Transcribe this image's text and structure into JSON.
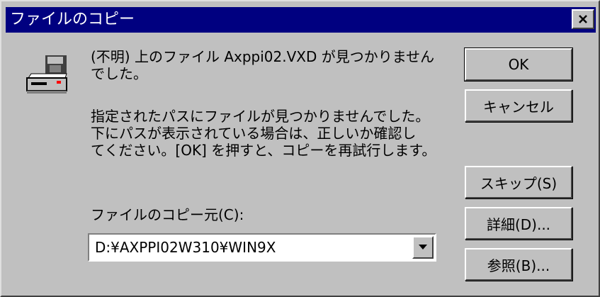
{
  "window": {
    "title": "ファイルのコピー"
  },
  "message": {
    "line1": "(不明) 上のファイル Axppi02.VXD が見つかりません",
    "line2": "でした。",
    "detail_line1": "指定されたパスにファイルが見つかりませんでした。",
    "detail_line2": "下にパスが表示されている場合は、正しいか確認し",
    "detail_line3": "てください。[OK] を押すと、コピーを再試行します。"
  },
  "source": {
    "label": "ファイルのコピー元(C):",
    "value": "D:¥AXPPI02W310¥WIN9X"
  },
  "buttons": {
    "ok": "OK",
    "cancel": "キャンセル",
    "skip": "スキップ(S)",
    "details": "詳細(D)...",
    "browse": "参照(B)..."
  },
  "icons": {
    "close": "close-icon",
    "disk": "floppy-drive-icon",
    "dropdown": "dropdown-arrow-icon"
  }
}
